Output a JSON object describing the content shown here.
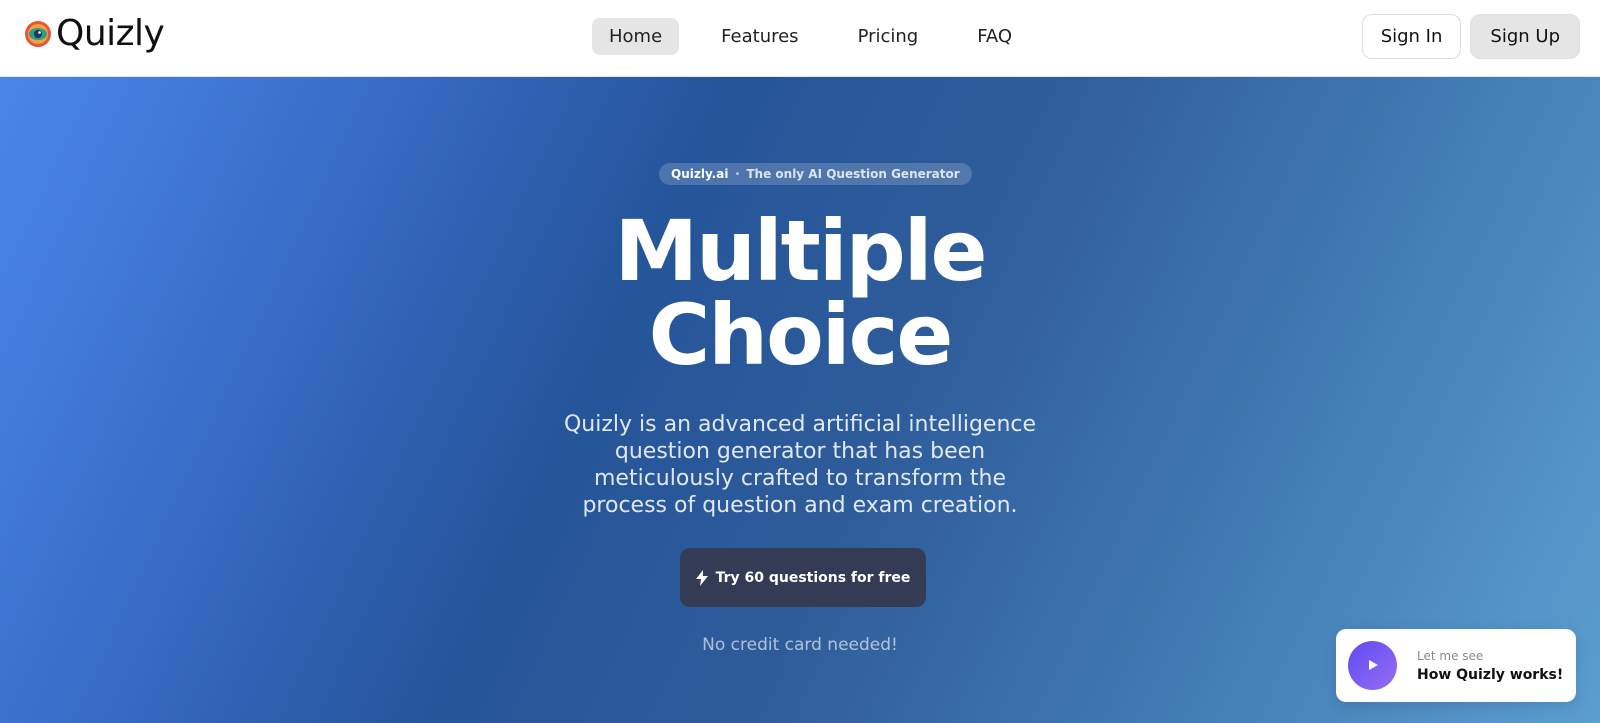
{
  "nav": {
    "brand_name": "Quizly",
    "logo_icon": "quizly-logo-icon",
    "links": [
      {
        "label": "Home",
        "active": true
      },
      {
        "label": "Features",
        "active": false
      },
      {
        "label": "Pricing",
        "active": false
      },
      {
        "label": "FAQ",
        "active": false
      }
    ],
    "sign_in_label": "Sign In",
    "sign_up_label": "Sign Up"
  },
  "hero": {
    "pill_brand": "Quizly.ai",
    "pill_separator": "•",
    "pill_text": "The only AI Question Generator",
    "headline_line1": "Multiple",
    "headline_line2": "Choice",
    "description": "Quizly is an advanced artificial intelligence question generator that has been meticulously crafted to transform the process of question and exam creation.",
    "cta_label": "Try 60 questions for free",
    "cta_icon": "lightning-bolt-icon",
    "no_credit_card": "No credit card needed!"
  },
  "video_card": {
    "kicker": "Let me see",
    "title": "How Quizly works!",
    "icon": "play-icon"
  },
  "colors": {
    "hero_gradient_start": "#4a86e8",
    "hero_gradient_mid": "#25559a",
    "hero_gradient_end": "#5c9ed0",
    "cta_background": "#343b55",
    "play_gradient_start": "#5b4cf0",
    "play_gradient_end": "#9a6cf5",
    "active_nav_background": "#e5e5e5"
  }
}
